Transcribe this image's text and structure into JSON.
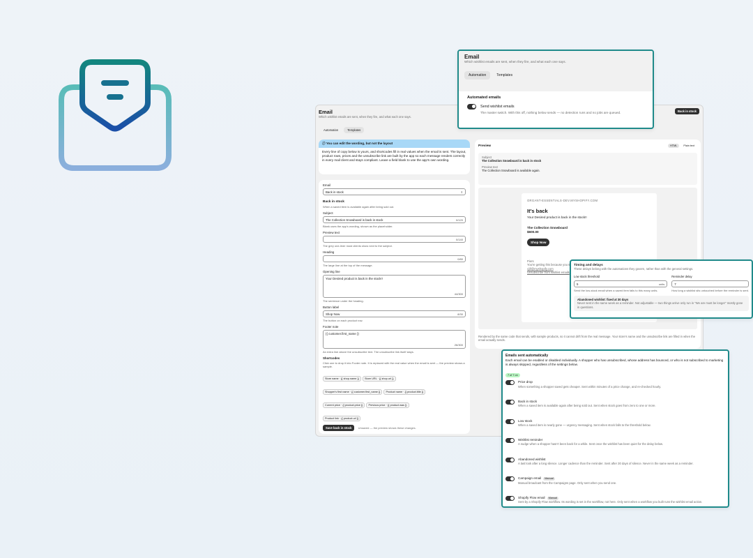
{
  "colors": {
    "teal": "#1f8a8a",
    "banner": "#a8d8f7",
    "dark": "#303030",
    "badge_green": "#b8f5c2"
  },
  "main": {
    "title": "Email",
    "subtitle": "Which wishlist emails are sent, when they fire, and what each one says.",
    "tabs": [
      "Automation",
      "Templates"
    ],
    "back_button": "Back in stock",
    "banner": {
      "title": "You can edit the wording, but not the layout",
      "body": "Every line of copy below is yours, and shortcodes fill in real values when the email is sent. The layout, product rows, prices and the unsubscribe link are built by the app so each message renders correctly in every mail client and stays compliant. Leave a field blank to use the app's own wording."
    },
    "form": {
      "email_label": "Email",
      "email_value": "Back in stock",
      "section_title": "Back in stock",
      "section_desc": "When a saved item is available again after being sold out.",
      "subject_label": "Subject",
      "subject_value": "The Collection Snowboard is back in stock",
      "subject_count": "0/120",
      "subject_help": "Blank uses the app's wording, shown as the placeholder.",
      "preview_label": "Preview text",
      "preview_count": "0/140",
      "preview_help": "The grey one-liner most clients show next to the subject.",
      "heading_label": "Heading",
      "heading_count": "0/80",
      "heading_help": "The large line at the top of the message.",
      "opening_label": "Opening line",
      "opening_value": "Your Desired product is back in the stock!!",
      "opening_count": "44/300",
      "opening_help": "The sentence under the heading.",
      "button_label": "Button label",
      "button_value": "Shop Now",
      "button_count": "8/30",
      "button_help": "The button on each product row.",
      "footer_label": "Footer note",
      "footer_value": "{{ customer.first_name }}",
      "footer_count": "26/300",
      "footer_help": "An extra line above the unsubscribe text. The unsubscribe link itself stays.",
      "shortcodes_title": "Shortcodes",
      "shortcodes_desc": "Click one to drop it into Footer note. It is replaced with the real value when the email is sent — the preview shows a sample.",
      "chips": [
        "Store name · {{ shop.name }}",
        "Store URL · {{ shop.url }}",
        "Shopper's first name · {{ customer.first_name }}",
        "Product name · {{ product.title }}",
        "Current price · {{ product.price }}",
        "Previous price · {{ product.was }}",
        "Product link · {{ product.url }}"
      ],
      "save_button": "Save back in stock",
      "save_note": "Unsaved — the preview shows these changes."
    },
    "preview": {
      "title": "Preview",
      "modes": [
        "HTML",
        "Plain text"
      ],
      "subject_label": "Subject",
      "subject": "The Collection Snowboard is back in stock",
      "ptext_label": "Preview text",
      "ptext": "The Collection Snowboard is available again.",
      "store": "ORGANT-ESSENTIALS-DEV.MYSHOPIFY.COM",
      "heading": "It's back",
      "opening": "Your Desired product is back in the stock!!",
      "product": "The Collection Snowboard",
      "price": "$600.00",
      "shop_button": "Shop Now",
      "foot1": "Piers",
      "foot2": "You're getting this because you saved...",
      "foot3": "cjill@myshopify.com",
      "foot_link": "Unsubscribe from wishlist emails",
      "caption": "Rendered by the same code that sends, with sample products, so it cannot drift from the real message. Your store's name and the unsubscribe link are filled in when the email actually sends."
    }
  },
  "email_card": {
    "title": "Email",
    "subtitle": "Which wishlist emails are sent, when they fire, and what each one says.",
    "tabs": [
      "Automation",
      "Templates"
    ],
    "section": "Automated emails",
    "toggle_label": "Send wishlist emails",
    "toggle_desc": "The master switch. With this off, nothing below sends — no detection runs and no jobs are queued."
  },
  "timing": {
    "title": "Timing and delays",
    "desc": "These delays belong with the automations they govern, rather than with the general settings.",
    "low_label": "Low stock threshold",
    "low_value": "5",
    "low_unit": "units",
    "low_help": "Send the low-stock email when a saved item falls to this many units.",
    "rem_label": "Reminder delay",
    "rem_value": "7",
    "rem_help": "How long a wishlist sits untouched before the reminder is sent.",
    "aband_title": "Abandoned wishlist: fixed at 30 days",
    "aband_desc": "Never sent in the same week as a reminder. Not adjustable — two things arrive only run in \"We are must be longer\" mostly gone in questions."
  },
  "auto": {
    "title": "Emails sent automatically",
    "desc": "Each email can be enabled or disabled individually. A shopper who has unsubscribed, whose address has bounced, or who is not subscribed to marketing is always skipped, regardless of the settings below.",
    "badge": "7 of 7 on",
    "items": [
      {
        "name": "Price drop",
        "desc": "When something a shopper saved gets cheaper. Sent within minutes of a price change, and re-checked hourly.",
        "tag": ""
      },
      {
        "name": "Back in stock",
        "desc": "When a saved item is available again after being sold out. Sent when stock goes from zero to one or more.",
        "tag": ""
      },
      {
        "name": "Low stock",
        "desc": "When a saved item is nearly gone — urgency messaging. Sent when stock falls to the threshold below.",
        "tag": ""
      },
      {
        "name": "Wishlist reminder",
        "desc": "A nudge when a shopper hasn't been back for a while. Sent once the wishlist has been quiet for the delay below.",
        "tag": ""
      },
      {
        "name": "Abandoned wishlist",
        "desc": "A last look after a long silence. Longer cadence than the reminder. Sent after 30 days of silence. Never in the same week as a reminder.",
        "tag": ""
      },
      {
        "name": "Campaign email",
        "desc": "Manual broadcast from the Campaigns page. Only sent when you send one.",
        "tag": "Manual"
      },
      {
        "name": "Shopify Flow email",
        "desc": "Sent by a Shopify Flow workflow. Its wording is set in the workflow, not here. Only sent when a workflow you built runs the wishlist email action.",
        "tag": "Manual"
      }
    ]
  }
}
